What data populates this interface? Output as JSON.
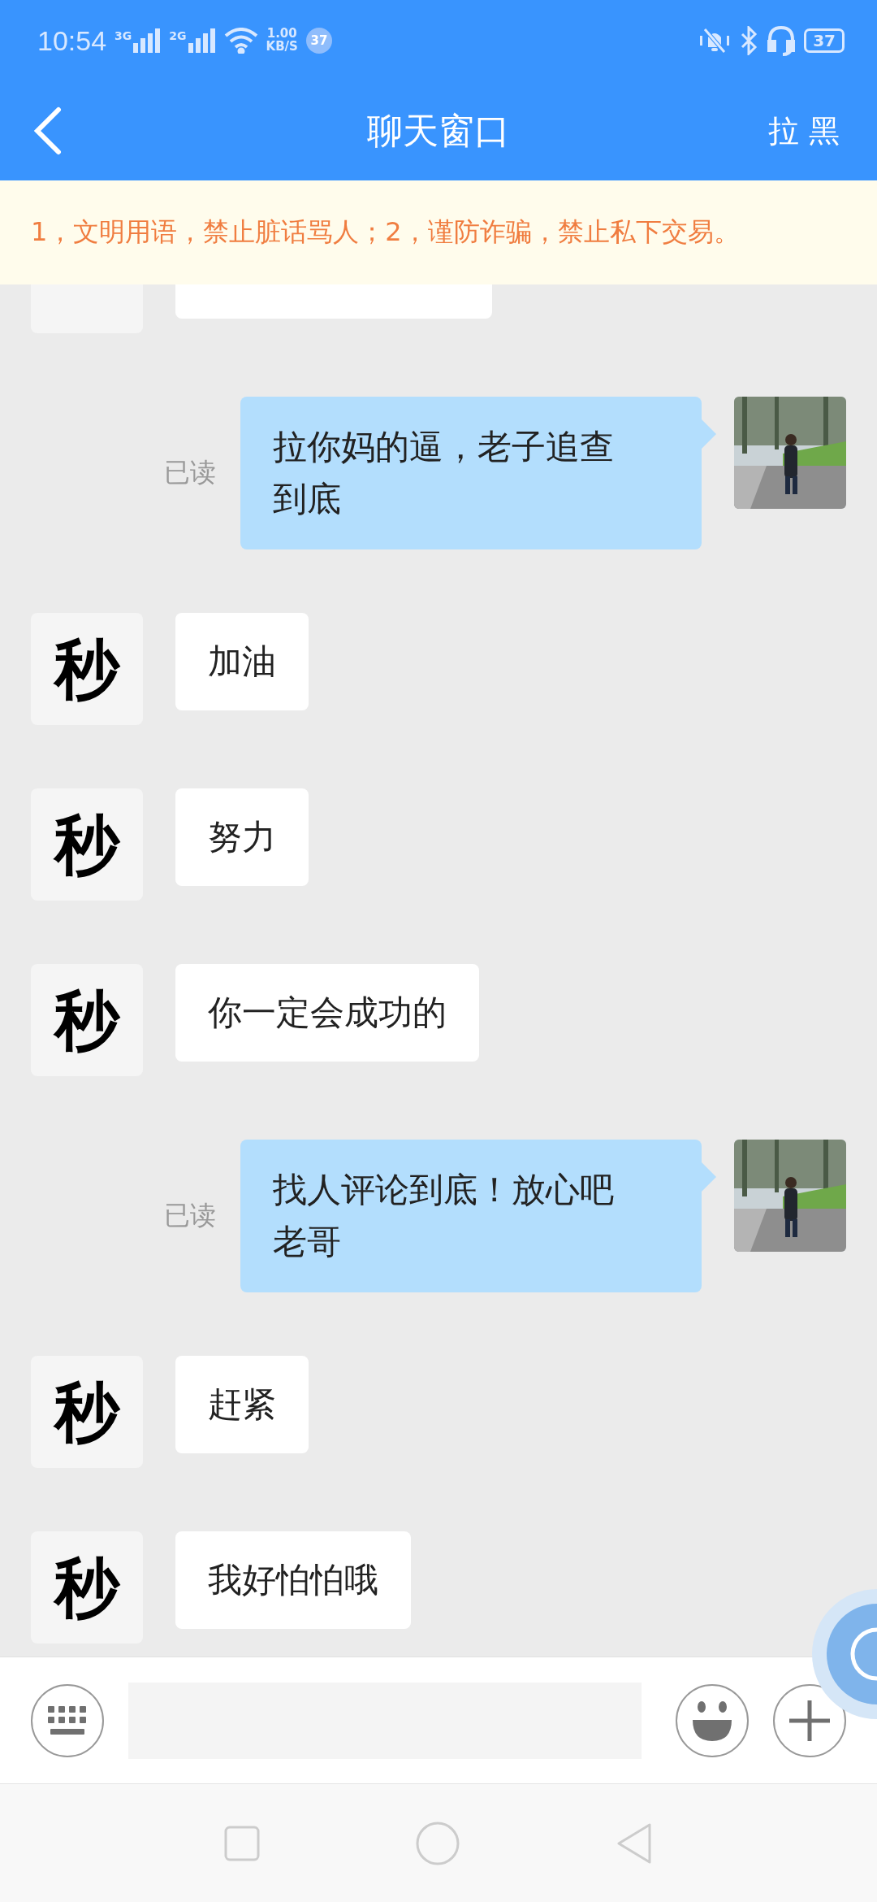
{
  "status_bar": {
    "time": "10:54",
    "network_1": "3G",
    "network_2": "2G",
    "speed_value": "1.00",
    "speed_unit": "KB/S",
    "notification_count": "37",
    "battery": "37"
  },
  "header": {
    "title": "聊天窗口",
    "action": "拉 黑"
  },
  "notice": "1，文明用语，禁止脏话骂人；2，谨防诈骗，禁止私下交易。",
  "messages": [
    {
      "kind": "partial"
    },
    {
      "kind": "sent",
      "text": "拉你妈的逼，老子追查到底",
      "status": "已读"
    },
    {
      "kind": "received",
      "text": "加油",
      "avatar": "秒"
    },
    {
      "kind": "received",
      "text": "努力",
      "avatar": "秒"
    },
    {
      "kind": "received",
      "text": "你一定会成功的",
      "avatar": "秒"
    },
    {
      "kind": "sent",
      "text": "找人评论到底！放心吧老哥",
      "status": "已读"
    },
    {
      "kind": "received",
      "text": "赶紧",
      "avatar": "秒"
    },
    {
      "kind": "received",
      "text": "我好怕怕哦",
      "avatar": "秒"
    }
  ]
}
